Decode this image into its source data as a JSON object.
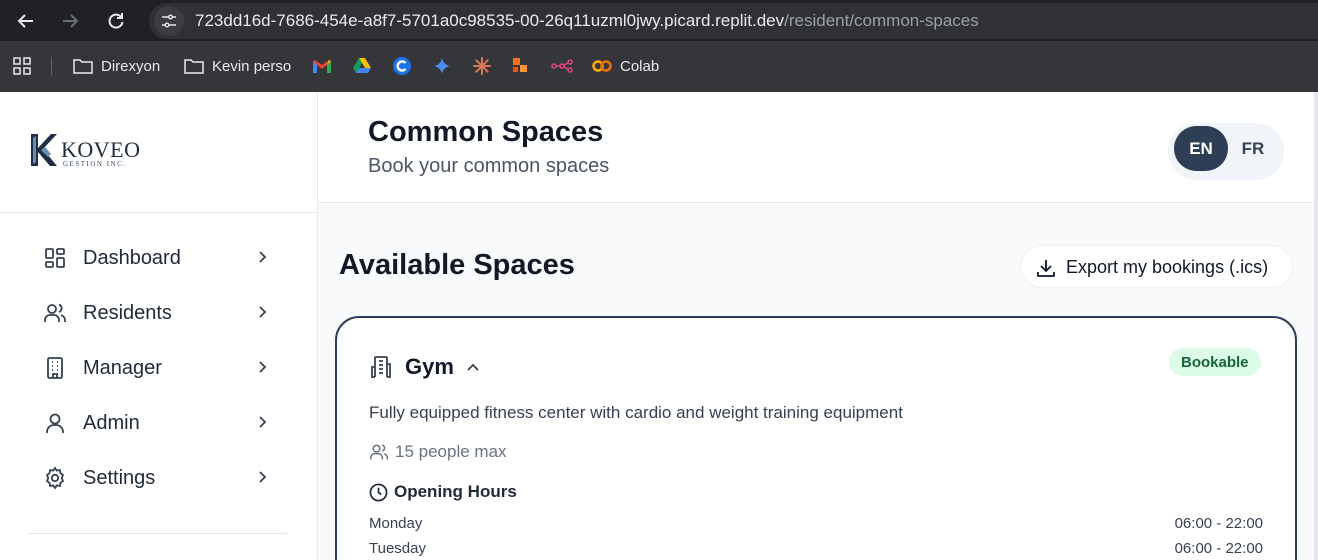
{
  "browser": {
    "url_host": "723dd16d-7686-454e-a8f7-5701a0c98535-00-26q11uzml0jwy.picard.replit.dev",
    "url_path": "/resident/common-spaces",
    "bookmarks": [
      {
        "label": "Direxyon",
        "icon": "folder-icon"
      },
      {
        "label": "Kevin perso",
        "icon": "folder-icon"
      },
      {
        "label": "",
        "icon": "gmail-icon"
      },
      {
        "label": "",
        "icon": "google-drive-icon"
      },
      {
        "label": "",
        "icon": "c-app-icon"
      },
      {
        "label": "",
        "icon": "gemini-icon"
      },
      {
        "label": "",
        "icon": "claude-icon"
      },
      {
        "label": "",
        "icon": "shape-icon"
      },
      {
        "label": "",
        "icon": "graph-icon"
      },
      {
        "label": "Colab",
        "icon": "colab-icon"
      }
    ]
  },
  "logo": {
    "main": "KOVEO",
    "sub": "GESTION INC."
  },
  "sidebar": {
    "items": [
      {
        "label": "Dashboard",
        "icon": "dashboard-icon"
      },
      {
        "label": "Residents",
        "icon": "users-icon"
      },
      {
        "label": "Manager",
        "icon": "building-icon"
      },
      {
        "label": "Admin",
        "icon": "user-icon"
      },
      {
        "label": "Settings",
        "icon": "gear-icon"
      }
    ]
  },
  "header": {
    "title": "Common Spaces",
    "subtitle": "Book your common spaces",
    "lang": {
      "en": "EN",
      "fr": "FR",
      "active": "EN"
    }
  },
  "main": {
    "title": "Available Spaces",
    "export_label": "Export my bookings (.ics)",
    "space": {
      "name": "Gym",
      "badge": "Bookable",
      "description": "Fully equipped fitness center with cardio and weight training equipment",
      "capacity": "15 people max",
      "hours_title": "Opening Hours",
      "hours": [
        {
          "day": "Monday",
          "time": "06:00 - 22:00"
        },
        {
          "day": "Tuesday",
          "time": "06:00 - 22:00"
        }
      ]
    }
  },
  "colors": {
    "accent": "#2d3e55",
    "badge_bg": "#dcfce7",
    "badge_text": "#166534",
    "chrome_dark": "#202124"
  }
}
